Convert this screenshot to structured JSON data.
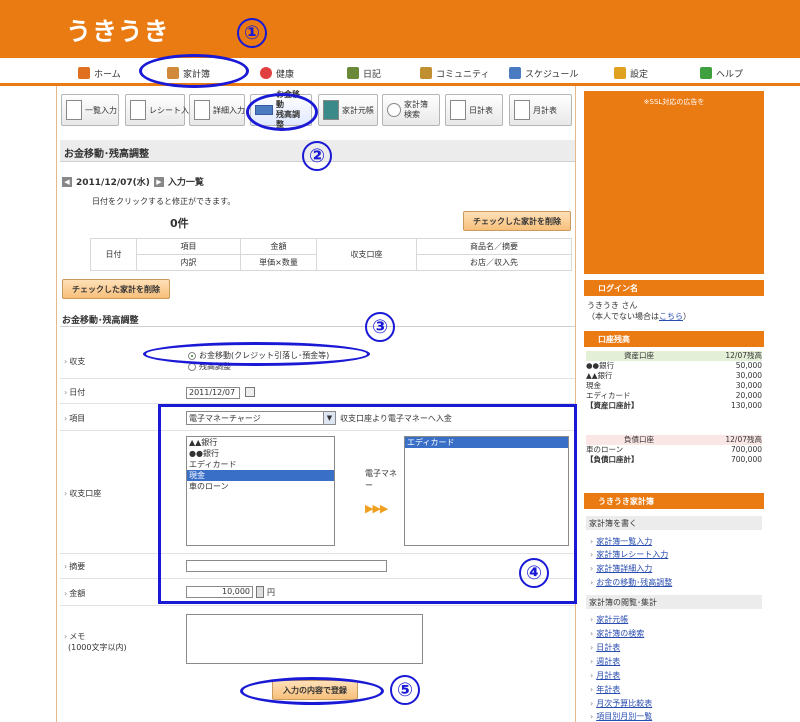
{
  "header": {
    "logo": "うきうき"
  },
  "nav": [
    {
      "label": "ホーム",
      "color": "#e07020"
    },
    {
      "label": "家計簿",
      "color": "#d08a3a"
    },
    {
      "label": "健康",
      "color": "#e04040"
    },
    {
      "label": "日記",
      "color": "#6a8a3a"
    },
    {
      "label": "コミュニティ",
      "color": "#c09030"
    },
    {
      "label": "スケジュール",
      "color": "#4a7ac0"
    },
    {
      "label": "設定",
      "color": "#e0a020"
    },
    {
      "label": "ヘルプ",
      "color": "#40a040"
    }
  ],
  "toolbar": [
    {
      "label": "一覧入力"
    },
    {
      "label": "レシート入力"
    },
    {
      "label": "詳細入力"
    },
    {
      "label": "お金移動\n残高調整"
    },
    {
      "label": "家計元帳"
    },
    {
      "label": "家計簿\n検索"
    },
    {
      "label": "日計表"
    },
    {
      "label": "月計表"
    }
  ],
  "page_title": "お金移動･残高調整",
  "entry_list": {
    "date": "2011/12/07(水)",
    "arrow_left": "◀",
    "arrow_right": "▶",
    "title": "入力一覧",
    "hint": "日付をクリックすると修正ができます。",
    "count": "0件",
    "delete_label": "チェックした家計を削除",
    "headers": {
      "date": "日付",
      "item": "項目",
      "amount": "金額",
      "account": "収支口座",
      "product": "商品名／摘要",
      "detail": "内訳",
      "unit": "単価×数量",
      "shop": "お店／収入先"
    }
  },
  "form": {
    "title": "お金移動･残高調整",
    "type_label": "収支",
    "type_options": [
      "お金移動(クレジット引落し･預金等)",
      "残高調整"
    ],
    "date_label": "日付",
    "date_value": "2011/12/07",
    "item_label": "項目",
    "item_value": "電子マネーチャージ",
    "item_desc": "収支口座より電子マネーへ入金",
    "account_label": "収支口座",
    "from_accounts": [
      "▲▲銀行",
      "●●銀行",
      "エディカード",
      "現金",
      "車のローン"
    ],
    "from_selected": 3,
    "mid_label": "電子マネー",
    "mid_arrows": "▶▶▶",
    "to_accounts": [
      "エディカード"
    ],
    "to_selected": 0,
    "memo_summary_label": "摘要",
    "amount_label": "金額",
    "amount_value": "10,000",
    "amount_unit": "円",
    "note_label": "メモ",
    "note_limit": "(1000文字以内)",
    "submit_label": "入力の内容で登録"
  },
  "annotations": [
    "①",
    "②",
    "③",
    "④",
    "⑤"
  ],
  "sidebar": {
    "ad_text": "※SSL対応の広告を",
    "login_title": "ログイン名",
    "user_name": "うきうき さん",
    "not_you_prefix": "（本人でない場合は",
    "not_you_link": "こちら",
    "not_you_suffix": "）",
    "balance_title": "口座残高",
    "assets_header": "資産口座",
    "assets_date": "12/07残高",
    "assets": [
      {
        "name": "●●銀行",
        "value": "50,000"
      },
      {
        "name": "▲▲銀行",
        "value": "30,000"
      },
      {
        "name": "現金",
        "value": "30,000"
      },
      {
        "name": "エディカード",
        "value": "20,000"
      }
    ],
    "assets_total_label": "【資産口座計】",
    "assets_total": "130,000",
    "liab_header": "負債口座",
    "liab_date": "12/07残高",
    "liab": [
      {
        "name": "車のローン",
        "value": "700,000"
      }
    ],
    "liab_total_label": "【負債口座計】",
    "liab_total": "700,000",
    "kakeibo_title": "うきうき家計簿",
    "write_title": "家計簿を書く",
    "write_links": [
      "家計簿一覧入力",
      "家計簿レシート入力",
      "家計簿詳細入力",
      "お金の移動･残高調整"
    ],
    "view_title": "家計簿の閲覧･集計",
    "view_links": [
      "家計元帳",
      "家計簿の検索",
      "日計表",
      "週計表",
      "月計表",
      "年計表",
      "月次予算比較表",
      "項目別月別一覧"
    ]
  }
}
